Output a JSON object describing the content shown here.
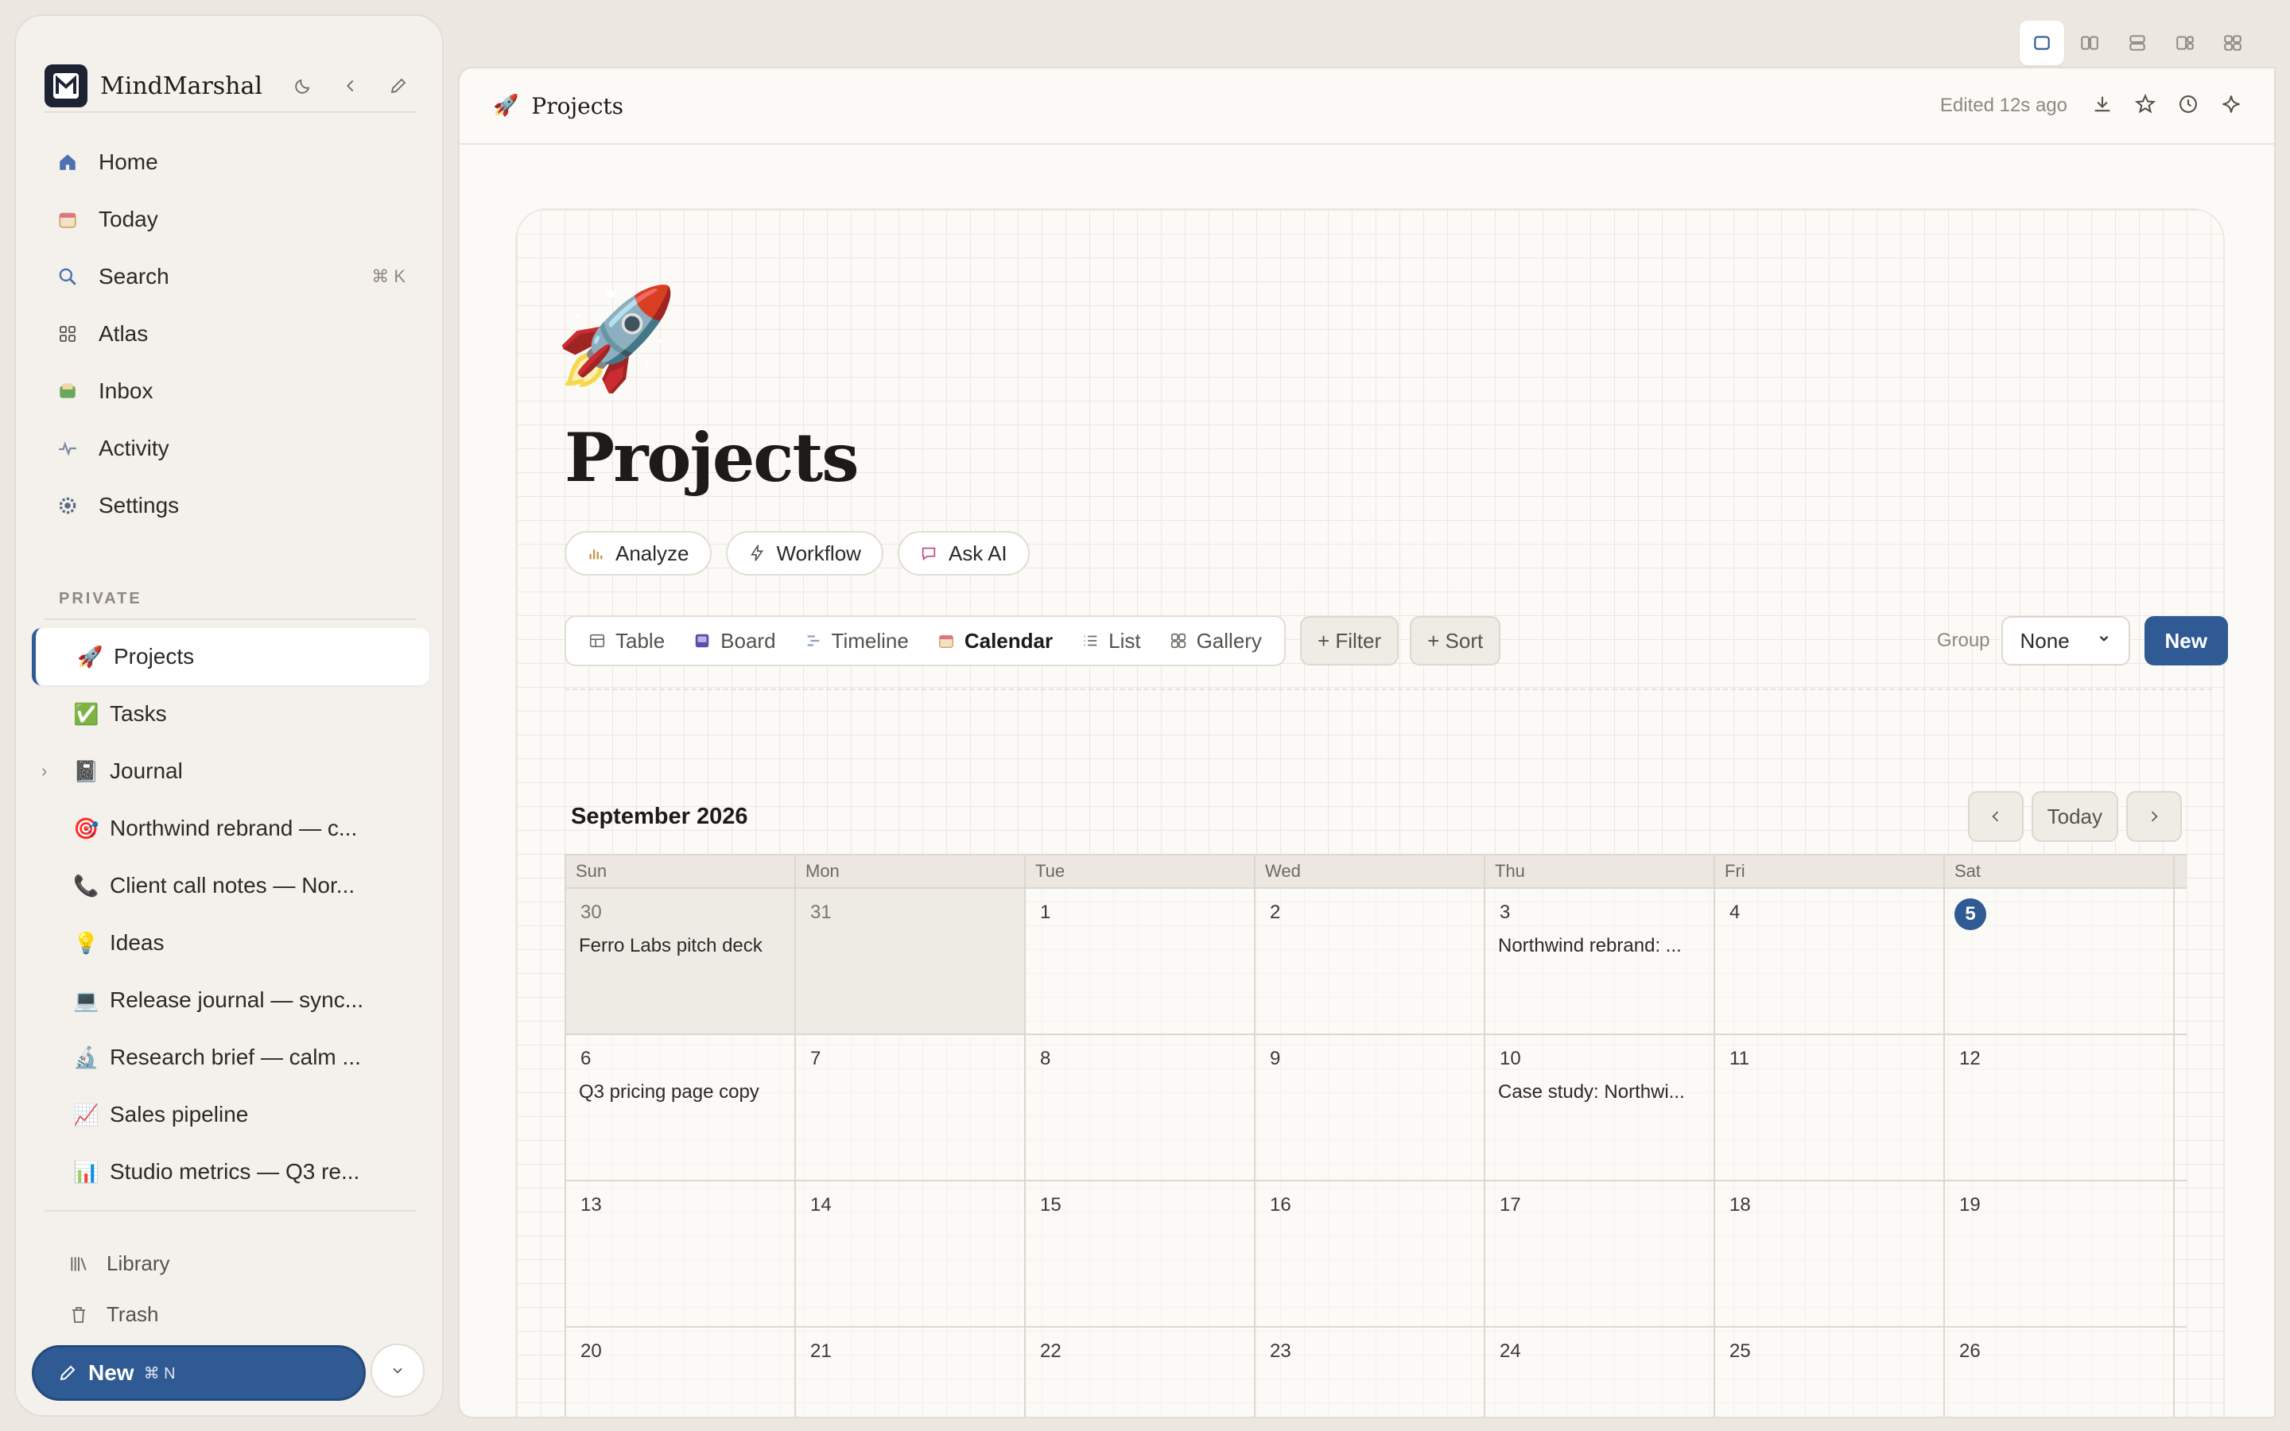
{
  "app": {
    "name": "MindMarshal"
  },
  "sidebar": {
    "nav": [
      {
        "label": "Home",
        "icon": "home-icon"
      },
      {
        "label": "Today",
        "icon": "calendar-icon"
      },
      {
        "label": "Search",
        "icon": "search-icon",
        "shortcut": "⌘ K"
      },
      {
        "label": "Atlas",
        "icon": "grid-icon"
      },
      {
        "label": "Inbox",
        "icon": "inbox-icon"
      },
      {
        "label": "Activity",
        "icon": "activity-icon"
      },
      {
        "label": "Settings",
        "icon": "gear-icon"
      }
    ],
    "section_label": "PRIVATE",
    "pages": [
      {
        "emoji": "🚀",
        "label": "Projects",
        "active": true
      },
      {
        "emoji": "✅",
        "label": "Tasks"
      },
      {
        "emoji": "📓",
        "label": "Journal",
        "expandable": true
      },
      {
        "emoji": "🎯",
        "label": "Northwind rebrand — c..."
      },
      {
        "emoji": "📞",
        "label": "Client call notes — Nor..."
      },
      {
        "emoji": "💡",
        "label": "Ideas"
      },
      {
        "emoji": "💻",
        "label": "Release journal — sync..."
      },
      {
        "emoji": "🔬",
        "label": "Research brief — calm ..."
      },
      {
        "emoji": "📈",
        "label": "Sales pipeline"
      },
      {
        "emoji": "📊",
        "label": "Studio metrics — Q3 re..."
      }
    ],
    "footer": {
      "library": "Library",
      "trash": "Trash"
    },
    "new_button": {
      "label": "New",
      "shortcut": "⌘ N"
    }
  },
  "header": {
    "emoji": "🚀",
    "title": "Projects",
    "edited": "Edited 12s ago"
  },
  "page": {
    "emoji": "🚀",
    "title": "Projects",
    "actions": [
      "Analyze",
      "Workflow",
      "Ask AI"
    ]
  },
  "toolbar": {
    "views": [
      {
        "label": "Table",
        "icon": "table-icon"
      },
      {
        "label": "Board",
        "icon": "board-icon"
      },
      {
        "label": "Timeline",
        "icon": "timeline-icon"
      },
      {
        "label": "Calendar",
        "icon": "calendar-icon",
        "active": true
      },
      {
        "label": "List",
        "icon": "list-icon"
      },
      {
        "label": "Gallery",
        "icon": "gallery-icon"
      }
    ],
    "filter": "+ Filter",
    "sort": "+ Sort",
    "group_label": "Group",
    "group_value": "None",
    "new_label": "New"
  },
  "calendar": {
    "month": "September 2026",
    "today_label": "Today",
    "weekdays": [
      "Sun",
      "Mon",
      "Tue",
      "Wed",
      "Thu",
      "Fri",
      "Sat"
    ],
    "weeks": [
      [
        {
          "day": "30",
          "muted": true,
          "event": "Ferro Labs pitch deck"
        },
        {
          "day": "31",
          "muted": true
        },
        {
          "day": "1"
        },
        {
          "day": "2"
        },
        {
          "day": "3",
          "event": "Northwind rebrand: ..."
        },
        {
          "day": "4"
        },
        {
          "day": "5",
          "today": true
        }
      ],
      [
        {
          "day": "6",
          "event": "Q3 pricing page copy"
        },
        {
          "day": "7"
        },
        {
          "day": "8"
        },
        {
          "day": "9"
        },
        {
          "day": "10",
          "event": "Case study: Northwi..."
        },
        {
          "day": "11"
        },
        {
          "day": "12"
        }
      ],
      [
        {
          "day": "13"
        },
        {
          "day": "14"
        },
        {
          "day": "15"
        },
        {
          "day": "16"
        },
        {
          "day": "17"
        },
        {
          "day": "18"
        },
        {
          "day": "19"
        }
      ],
      [
        {
          "day": "20"
        },
        {
          "day": "21"
        },
        {
          "day": "22"
        },
        {
          "day": "23"
        },
        {
          "day": "24"
        },
        {
          "day": "25"
        },
        {
          "day": "26"
        }
      ]
    ]
  },
  "colors": {
    "accent": "#2f5a94",
    "background": "#ece8e1",
    "panel": "#fbfaf7"
  }
}
